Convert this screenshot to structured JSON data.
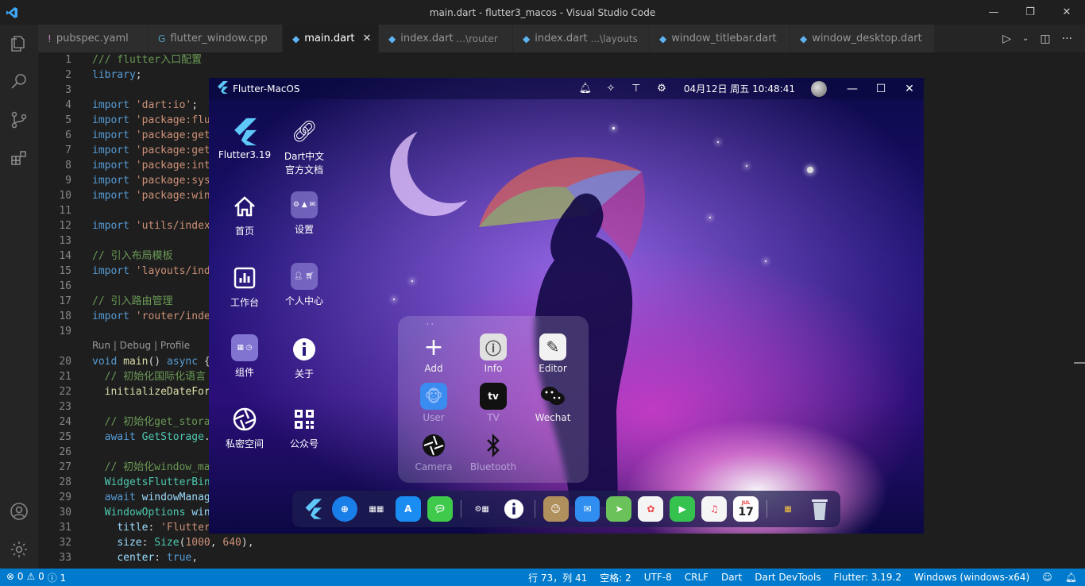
{
  "window": {
    "title": "main.dart - flutter3_macos - Visual Studio Code",
    "controls": [
      "—",
      "❐",
      "✕"
    ]
  },
  "tabs": [
    {
      "icon": "!",
      "icon_color": "#c586c0",
      "label": "pubspec.yaml",
      "path": "",
      "active": false
    },
    {
      "icon": "G",
      "icon_color": "#519aba",
      "label": "flutter_window.cpp",
      "path": "",
      "active": false
    },
    {
      "icon": "◆",
      "icon_color": "#5fb3f2",
      "label": "main.dart",
      "path": "",
      "active": true
    },
    {
      "icon": "◆",
      "icon_color": "#5fb3f2",
      "label": "index.dart",
      "path": "...\\router",
      "active": false
    },
    {
      "icon": "◆",
      "icon_color": "#5fb3f2",
      "label": "index.dart",
      "path": "...\\layouts",
      "active": false
    },
    {
      "icon": "◆",
      "icon_color": "#5fb3f2",
      "label": "window_titlebar.dart",
      "path": "",
      "active": false
    },
    {
      "icon": "◆",
      "icon_color": "#5fb3f2",
      "label": "window_desktop.dart",
      "path": "",
      "active": false
    }
  ],
  "code_lines": [
    {
      "n": "1",
      "parts": [
        [
          "cm",
          "/// flutter入口配置"
        ]
      ]
    },
    {
      "n": "2",
      "parts": [
        [
          "kw",
          "library"
        ],
        [
          "pl",
          ";"
        ]
      ]
    },
    {
      "n": "3",
      "parts": []
    },
    {
      "n": "4",
      "parts": [
        [
          "kw",
          "import"
        ],
        [
          "pl",
          " "
        ],
        [
          "str",
          "'dart:io'"
        ],
        [
          "pl",
          ";"
        ]
      ]
    },
    {
      "n": "5",
      "parts": [
        [
          "kw",
          "import"
        ],
        [
          "pl",
          " "
        ],
        [
          "str",
          "'package:flu"
        ]
      ]
    },
    {
      "n": "6",
      "parts": [
        [
          "kw",
          "import"
        ],
        [
          "pl",
          " "
        ],
        [
          "str",
          "'package:get"
        ]
      ]
    },
    {
      "n": "7",
      "parts": [
        [
          "kw",
          "import"
        ],
        [
          "pl",
          " "
        ],
        [
          "str",
          "'package:get"
        ]
      ]
    },
    {
      "n": "8",
      "parts": [
        [
          "kw",
          "import"
        ],
        [
          "pl",
          " "
        ],
        [
          "str",
          "'package:int"
        ]
      ]
    },
    {
      "n": "9",
      "parts": [
        [
          "kw",
          "import"
        ],
        [
          "pl",
          " "
        ],
        [
          "str",
          "'package:sys"
        ]
      ]
    },
    {
      "n": "10",
      "parts": [
        [
          "kw",
          "import"
        ],
        [
          "pl",
          " "
        ],
        [
          "str",
          "'package:win"
        ]
      ]
    },
    {
      "n": "11",
      "parts": []
    },
    {
      "n": "12",
      "parts": [
        [
          "kw",
          "import"
        ],
        [
          "pl",
          " "
        ],
        [
          "str",
          "'utils/index"
        ]
      ]
    },
    {
      "n": "13",
      "parts": []
    },
    {
      "n": "14",
      "parts": [
        [
          "cm",
          "// 引入布局模板"
        ]
      ]
    },
    {
      "n": "15",
      "parts": [
        [
          "kw",
          "import"
        ],
        [
          "pl",
          " "
        ],
        [
          "str",
          "'layouts/ind"
        ]
      ]
    },
    {
      "n": "16",
      "parts": []
    },
    {
      "n": "17",
      "parts": [
        [
          "cm",
          "// 引入路由管理"
        ]
      ]
    },
    {
      "n": "18",
      "parts": [
        [
          "kw",
          "import"
        ],
        [
          "pl",
          " "
        ],
        [
          "str",
          "'router/inde"
        ]
      ]
    },
    {
      "n": "19",
      "parts": []
    },
    {
      "n": "20",
      "parts": [
        [
          "kw",
          "void"
        ],
        [
          "pl",
          " "
        ],
        [
          "fn",
          "main"
        ],
        [
          "pl",
          "() "
        ],
        [
          "kw",
          "async"
        ],
        [
          "pl",
          " {"
        ]
      ]
    },
    {
      "n": "21",
      "parts": [
        [
          "pl",
          "  "
        ],
        [
          "cm",
          "// 初始化国际化语言"
        ]
      ]
    },
    {
      "n": "22",
      "parts": [
        [
          "pl",
          "  "
        ],
        [
          "fn",
          "initializeDateFor"
        ]
      ]
    },
    {
      "n": "23",
      "parts": []
    },
    {
      "n": "24",
      "parts": [
        [
          "pl",
          "  "
        ],
        [
          "cm",
          "// 初始化get_stora"
        ]
      ]
    },
    {
      "n": "25",
      "parts": [
        [
          "pl",
          "  "
        ],
        [
          "kw",
          "await"
        ],
        [
          "pl",
          " "
        ],
        [
          "ty",
          "GetStorage"
        ],
        [
          "pl",
          "."
        ]
      ]
    },
    {
      "n": "26",
      "parts": []
    },
    {
      "n": "27",
      "parts": [
        [
          "pl",
          "  "
        ],
        [
          "cm",
          "// 初始化window_ma"
        ]
      ]
    },
    {
      "n": "28",
      "parts": [
        [
          "pl",
          "  "
        ],
        [
          "ty",
          "WidgetsFlutterBin"
        ]
      ]
    },
    {
      "n": "29",
      "parts": [
        [
          "pl",
          "  "
        ],
        [
          "kw",
          "await"
        ],
        [
          "pl",
          " "
        ],
        [
          "vr",
          "windowManag"
        ]
      ]
    },
    {
      "n": "30",
      "parts": [
        [
          "pl",
          "  "
        ],
        [
          "ty",
          "WindowOptions"
        ],
        [
          "pl",
          " "
        ],
        [
          "vr",
          "win"
        ]
      ]
    },
    {
      "n": "31",
      "parts": [
        [
          "pl",
          "    "
        ],
        [
          "vr",
          "title"
        ],
        [
          "pl",
          ": "
        ],
        [
          "str",
          "'Flutter"
        ]
      ]
    },
    {
      "n": "32",
      "parts": [
        [
          "pl",
          "    "
        ],
        [
          "vr",
          "size"
        ],
        [
          "pl",
          ": "
        ],
        [
          "ty",
          "Size"
        ],
        [
          "pl",
          "("
        ],
        [
          "str",
          "1000"
        ],
        [
          "pl",
          ", "
        ],
        [
          "str",
          "640"
        ],
        [
          "pl",
          "),"
        ]
      ]
    },
    {
      "n": "33",
      "parts": [
        [
          "pl",
          "    "
        ],
        [
          "vr",
          "center"
        ],
        [
          "pl",
          ": "
        ],
        [
          "kw",
          "true"
        ],
        [
          "pl",
          ","
        ]
      ]
    }
  ],
  "codelens": "Run | Debug | Profile",
  "status": {
    "left": [
      "⊗ 0",
      "⚠ 0",
      "ⓘ 1"
    ],
    "right": [
      "行 73，列 41",
      "空格: 2",
      "UTF-8",
      "CRLF",
      "Dart",
      "Dart DevTools",
      "Flutter: 3.19.2",
      "Windows (windows-x64)"
    ]
  },
  "app": {
    "title": "Flutter-MacOS",
    "clock": "04月12日 周五 10:48:41",
    "nav": [
      {
        "label": "Flutter3.19",
        "icon": "flutter-icon"
      },
      {
        "label": "Dart中文官方文档",
        "icon": "link-icon"
      },
      {
        "label": "首页",
        "icon": "home-icon"
      },
      {
        "label": "设置",
        "icon": "settings-tile-icon"
      },
      {
        "label": "工作台",
        "icon": "chart-icon"
      },
      {
        "label": "个人中心",
        "icon": "profile-tile-icon"
      },
      {
        "label": "组件",
        "icon": "components-tile-icon"
      },
      {
        "label": "关于",
        "icon": "info-icon"
      },
      {
        "label": "私密空间",
        "icon": "aperture-icon"
      },
      {
        "label": "公众号",
        "icon": "qrcode-icon"
      }
    ],
    "launcher": [
      {
        "label": "Add",
        "icon": "plus-icon",
        "dim": false
      },
      {
        "label": "Info",
        "icon": "info-icon",
        "dim": false
      },
      {
        "label": "Editor",
        "icon": "editor-icon",
        "dim": false
      },
      {
        "label": "User",
        "icon": "user-avatar-icon",
        "dim": true
      },
      {
        "label": "TV",
        "icon": "apple-tv-icon",
        "dim": true
      },
      {
        "label": "Wechat",
        "icon": "wechat-icon",
        "dim": false
      },
      {
        "label": "Camera",
        "icon": "camera-aperture-icon",
        "dim": true
      },
      {
        "label": "Bluetooth",
        "icon": "bluetooth-icon",
        "dim": true
      }
    ],
    "dock": [
      {
        "name": "flutter",
        "color": "#1e2a6e"
      },
      {
        "name": "safari",
        "color": "#1a7ee8"
      },
      {
        "name": "launchpad",
        "color": "#2b2e7a"
      },
      {
        "name": "appstore",
        "color": "#1b8df2"
      },
      {
        "name": "messages",
        "color": "#3fca4b"
      },
      {
        "name": "widgets",
        "color": "#2b2e7a"
      },
      {
        "name": "info",
        "color": "#2b2e7a"
      },
      {
        "name": "finder",
        "color": "#b0905c"
      },
      {
        "name": "mail",
        "color": "#2f8ef0"
      },
      {
        "name": "maps",
        "color": "#6cc25a"
      },
      {
        "name": "photos",
        "color": "#f4f4f4"
      },
      {
        "name": "facetime",
        "color": "#36c24e"
      },
      {
        "name": "music",
        "color": "#f5f5f5"
      },
      {
        "name": "calendar",
        "color": "#ffffff",
        "text": "17"
      },
      {
        "name": "folder",
        "color": "#2b2e7a"
      },
      {
        "name": "trash",
        "color": "#c9d3e0"
      }
    ]
  }
}
